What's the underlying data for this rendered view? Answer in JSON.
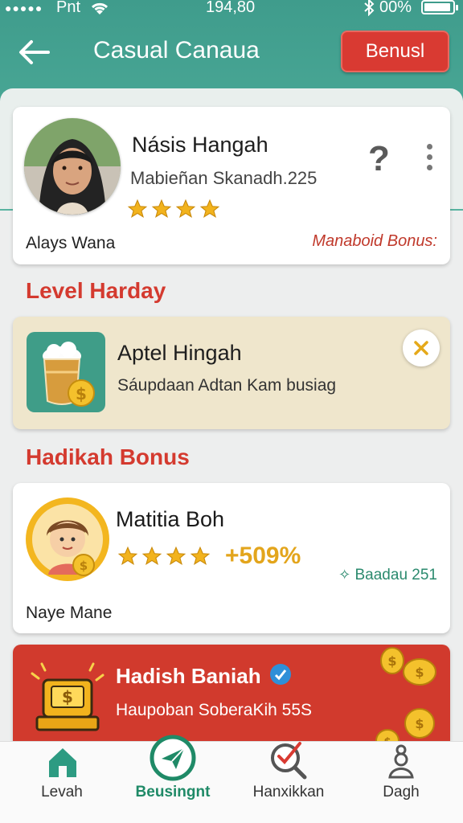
{
  "status_bar": {
    "carrier": "Pnt",
    "time": "194,80",
    "battery": "00%"
  },
  "header": {
    "title": "Casual Canaua",
    "bonus_button": "Benusl"
  },
  "profile": {
    "name": "Násis Hangah",
    "subtitle": "Mabieñan Skanadh.225",
    "rating": 4,
    "footer_label": "Alays Wana",
    "bonus_link": "Manaboid Bonus:"
  },
  "sections": {
    "level_title": "Level Harday",
    "bonus_title": "Hadikah Bonus"
  },
  "level_card": {
    "title": "Aptel Hingah",
    "subtitle": "Sáupdaan Adtan Kam busiag"
  },
  "bonus_card": {
    "name": "Matitia Boh",
    "rating": 4,
    "percent": "+509%",
    "badge": "Baadau 251",
    "footer_label": "Naye Mane"
  },
  "promo_card": {
    "title": "Hadish Baniah",
    "subtitle": "Haupoban SoberaKih 55S"
  },
  "tabs": [
    {
      "label": "Levah",
      "icon": "home-icon"
    },
    {
      "label": "Beusingnt",
      "icon": "send-icon",
      "active": true
    },
    {
      "label": "Hanxikkan",
      "icon": "check-search-icon"
    },
    {
      "label": "Dagh",
      "icon": "user-icon"
    }
  ],
  "colors": {
    "teal": "#4aa896",
    "red": "#d93a32",
    "gold": "#f2b31d",
    "active_tab": "#1f8a67"
  }
}
